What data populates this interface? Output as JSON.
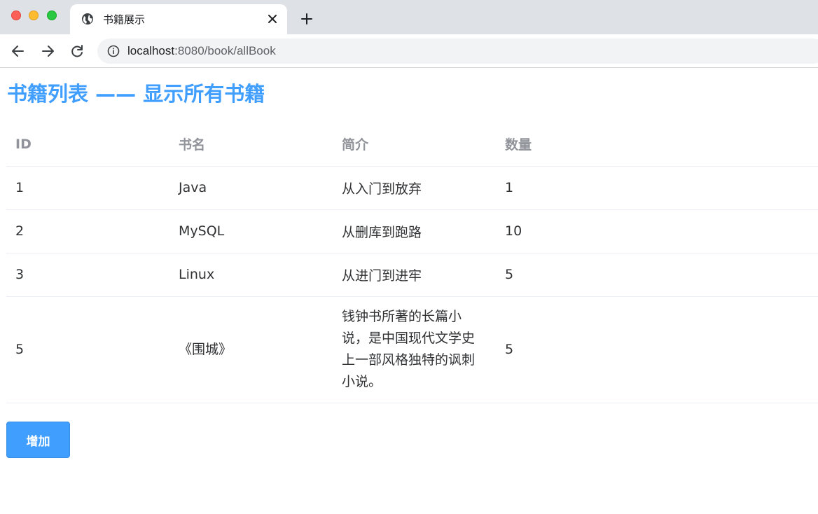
{
  "browser": {
    "tab_title": "书籍展示",
    "url_host": "localhost",
    "url_path": ":8080/book/allBook"
  },
  "page": {
    "title": "书籍列表 —— 显示所有书籍",
    "add_button": "增加"
  },
  "table": {
    "headers": [
      "ID",
      "书名",
      "简介",
      "数量"
    ],
    "rows": [
      [
        "1",
        "Java",
        "从入门到放弃",
        "1"
      ],
      [
        "2",
        "MySQL",
        "从删库到跑路",
        "10"
      ],
      [
        "3",
        "Linux",
        "从进门到进牢",
        "5"
      ],
      [
        "5",
        "《围城》",
        "钱钟书所著的长篇小说，是中国现代文学史上一部风格独特的讽刺小说。",
        "5"
      ]
    ]
  },
  "colors": {
    "accent": "#409eff",
    "header_text": "#909399",
    "body_text": "#303133"
  }
}
